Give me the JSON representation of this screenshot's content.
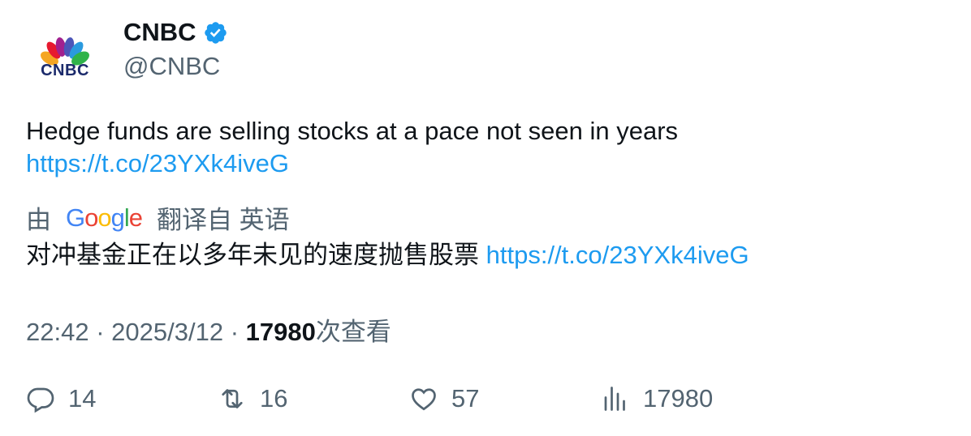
{
  "author": {
    "avatar_icon": "cnbc-peacock-logo",
    "avatar_text": "CNBC",
    "display_name": "CNBC",
    "verified_icon": "verified-badge-icon",
    "handle": "@CNBC"
  },
  "tweet": {
    "text": "Hedge funds are selling stocks at a pace not seen in years",
    "link": "https://t.co/23YXk4iveG"
  },
  "translation": {
    "prefix": "由",
    "provider": "Google",
    "suffix": "翻译自 英语",
    "text": "对冲基金正在以多年未见的速度抛售股票",
    "link": "https://t.co/23YXk4iveG"
  },
  "meta": {
    "time": "22:42",
    "separator": "·",
    "date": "2025/3/12",
    "views_count": "17980",
    "views_label": "次查看"
  },
  "actions": {
    "replies": "14",
    "retweets": "16",
    "likes": "57",
    "views": "17980"
  },
  "colors": {
    "link": "#1d9bf0",
    "secondary_text": "#536471",
    "primary_text": "#0f1419",
    "verified": "#1d9bf0"
  }
}
